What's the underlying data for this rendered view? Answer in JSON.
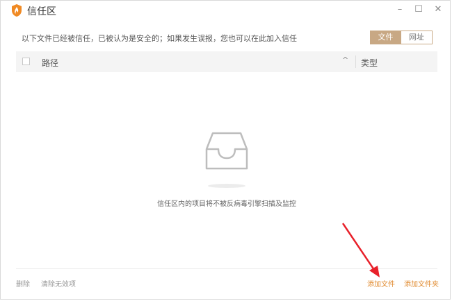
{
  "window": {
    "title": "信任区",
    "controls": {
      "minimize": "–",
      "maximize": "☐",
      "close": "✕"
    }
  },
  "info": {
    "text": "以下文件已经被信任，已被认为是安全的；如果发生误报，您也可以在此加入信任"
  },
  "tabs": [
    {
      "label": "文件",
      "active": true
    },
    {
      "label": "网址",
      "active": false
    }
  ],
  "table": {
    "columns": {
      "path": "路径",
      "sort_indicator": "^",
      "type": "类型"
    },
    "rows": []
  },
  "empty_state": {
    "icon": "empty-tray-icon",
    "message": "信任区内的项目将不被反病毒引擎扫描及监控"
  },
  "footer": {
    "delete_label": "删除",
    "clear_invalid_label": "清除无效项",
    "add_file_label": "添加文件",
    "add_folder_label": "添加文件夹"
  },
  "colors": {
    "accent": "#c8a884",
    "link_orange": "#e0882b",
    "annotation_arrow": "#e8202a",
    "logo": "#f08a24"
  }
}
